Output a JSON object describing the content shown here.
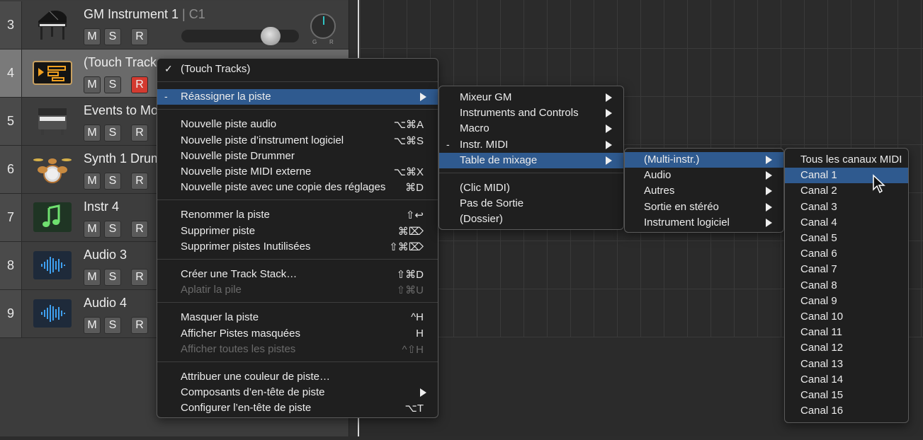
{
  "tracks": [
    {
      "num": "3",
      "name": "GM Instrument 1",
      "sub": " | C1",
      "icon": "piano-icon",
      "rec_on": false
    },
    {
      "num": "4",
      "name": "(Touch Track",
      "sub": "",
      "icon": "touch-tracks-icon",
      "rec_on": true
    },
    {
      "num": "5",
      "name": "Events to Mo",
      "sub": "",
      "icon": "keyboard-icon",
      "rec_on": false
    },
    {
      "num": "6",
      "name": "Synth 1 Drum",
      "sub": "",
      "icon": "drum-kit-icon",
      "rec_on": false
    },
    {
      "num": "7",
      "name": "Instr 4",
      "sub": "",
      "icon": "music-note-icon",
      "rec_on": false
    },
    {
      "num": "8",
      "name": "Audio 3",
      "sub": "",
      "icon": "waveform-icon",
      "rec_on": false
    },
    {
      "num": "9",
      "name": "Audio 4",
      "sub": "",
      "icon": "waveform-icon",
      "rec_on": false
    }
  ],
  "track_buttons": {
    "mute": "M",
    "solo": "S",
    "record": "R"
  },
  "pan_labels": {
    "left": "G",
    "right": "R"
  },
  "context_menu": {
    "items": [
      {
        "label": "(Touch Tracks)",
        "mark": "✓",
        "shortcut": "",
        "submenu": false,
        "disabled": false,
        "highlighted": false
      },
      {
        "label": "Réassigner la piste",
        "mark": "-",
        "shortcut": "",
        "submenu": true,
        "disabled": false,
        "highlighted": true
      },
      {
        "label": "Nouvelle piste audio",
        "mark": "",
        "shortcut": "⌥⌘A",
        "submenu": false,
        "disabled": false,
        "highlighted": false
      },
      {
        "label": "Nouvelle piste d’instrument logiciel",
        "mark": "",
        "shortcut": "⌥⌘S",
        "submenu": false,
        "disabled": false,
        "highlighted": false
      },
      {
        "label": "Nouvelle piste Drummer",
        "mark": "",
        "shortcut": "",
        "submenu": false,
        "disabled": false,
        "highlighted": false
      },
      {
        "label": "Nouvelle piste MIDI externe",
        "mark": "",
        "shortcut": "⌥⌘X",
        "submenu": false,
        "disabled": false,
        "highlighted": false
      },
      {
        "label": "Nouvelle piste avec une copie des réglages",
        "mark": "",
        "shortcut": "⌘D",
        "submenu": false,
        "disabled": false,
        "highlighted": false
      },
      {
        "label": "Renommer la piste",
        "mark": "",
        "shortcut": "⇧↩",
        "submenu": false,
        "disabled": false,
        "highlighted": false
      },
      {
        "label": "Supprimer piste",
        "mark": "",
        "shortcut": "⌘⌦",
        "submenu": false,
        "disabled": false,
        "highlighted": false
      },
      {
        "label": "Supprimer pistes Inutilisées",
        "mark": "",
        "shortcut": "⇧⌘⌦",
        "submenu": false,
        "disabled": false,
        "highlighted": false
      },
      {
        "label": "Créer une Track Stack…",
        "mark": "",
        "shortcut": "⇧⌘D",
        "submenu": false,
        "disabled": false,
        "highlighted": false
      },
      {
        "label": "Aplatir la pile",
        "mark": "",
        "shortcut": "⇧⌘U",
        "submenu": false,
        "disabled": true,
        "highlighted": false
      },
      {
        "label": "Masquer la piste",
        "mark": "",
        "shortcut": "^H",
        "submenu": false,
        "disabled": false,
        "highlighted": false
      },
      {
        "label": "Afficher Pistes masquées",
        "mark": "",
        "shortcut": "H",
        "submenu": false,
        "disabled": false,
        "highlighted": false
      },
      {
        "label": "Afficher toutes les pistes",
        "mark": "",
        "shortcut": "^⇧H",
        "submenu": false,
        "disabled": true,
        "highlighted": false
      },
      {
        "label": "Attribuer une couleur de piste…",
        "mark": "",
        "shortcut": "",
        "submenu": false,
        "disabled": false,
        "highlighted": false
      },
      {
        "label": "Composants d’en-tête de piste",
        "mark": "",
        "shortcut": "",
        "submenu": true,
        "disabled": false,
        "highlighted": false
      },
      {
        "label": "Configurer l’en-tête de piste",
        "mark": "",
        "shortcut": "⌥T",
        "submenu": false,
        "disabled": false,
        "highlighted": false
      }
    ]
  },
  "submenu_reassign": {
    "items": [
      {
        "label": "Mixeur GM",
        "mark": "",
        "submenu": true,
        "highlighted": false
      },
      {
        "label": "Instruments and Controls",
        "mark": "",
        "submenu": true,
        "highlighted": false
      },
      {
        "label": "Macro",
        "mark": "",
        "submenu": true,
        "highlighted": false
      },
      {
        "label": "Instr. MIDI",
        "mark": "-",
        "submenu": true,
        "highlighted": false
      },
      {
        "label": "Table de mixage",
        "mark": "",
        "submenu": true,
        "highlighted": true
      },
      {
        "label": "(Clic MIDI)",
        "mark": "",
        "submenu": false,
        "highlighted": false
      },
      {
        "label": "Pas de Sortie",
        "mark": "",
        "submenu": false,
        "highlighted": false
      },
      {
        "label": "(Dossier)",
        "mark": "",
        "submenu": false,
        "highlighted": false
      }
    ]
  },
  "submenu_mixer": {
    "items": [
      {
        "label": "(Multi-instr.)",
        "submenu": true,
        "highlighted": true
      },
      {
        "label": "Audio",
        "submenu": true,
        "highlighted": false
      },
      {
        "label": "Autres",
        "submenu": true,
        "highlighted": false
      },
      {
        "label": "Sortie en stéréo",
        "submenu": true,
        "highlighted": false
      },
      {
        "label": "Instrument logiciel",
        "submenu": true,
        "highlighted": false
      }
    ]
  },
  "submenu_channels": {
    "items": [
      {
        "label": "Tous les canaux MIDI",
        "highlighted": false
      },
      {
        "label": "Canal  1",
        "highlighted": true
      },
      {
        "label": "Canal  2",
        "highlighted": false
      },
      {
        "label": "Canal  3",
        "highlighted": false
      },
      {
        "label": "Canal  4",
        "highlighted": false
      },
      {
        "label": "Canal  5",
        "highlighted": false
      },
      {
        "label": "Canal  6",
        "highlighted": false
      },
      {
        "label": "Canal  7",
        "highlighted": false
      },
      {
        "label": "Canal  8",
        "highlighted": false
      },
      {
        "label": "Canal  9",
        "highlighted": false
      },
      {
        "label": "Canal 10",
        "highlighted": false
      },
      {
        "label": "Canal 11",
        "highlighted": false
      },
      {
        "label": "Canal 12",
        "highlighted": false
      },
      {
        "label": "Canal 13",
        "highlighted": false
      },
      {
        "label": "Canal 14",
        "highlighted": false
      },
      {
        "label": "Canal 15",
        "highlighted": false
      },
      {
        "label": "Canal 16",
        "highlighted": false
      }
    ]
  },
  "colors": {
    "highlight": "#2f5a8f",
    "record_active": "#d33a30",
    "pan_indicator": "#2fc4c4"
  }
}
